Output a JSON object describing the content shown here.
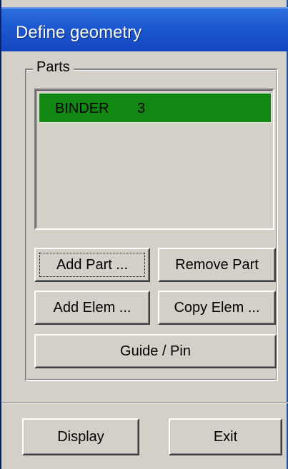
{
  "window": {
    "title": "Define geometry"
  },
  "parts_group": {
    "legend": "Parts",
    "list": [
      {
        "name": "BINDER",
        "number": "3",
        "selected": true,
        "highlight_color": "#118811"
      }
    ]
  },
  "buttons": {
    "add_part": "Add Part ...",
    "remove_part": "Remove Part",
    "add_elem": "Add Elem ...",
    "copy_elem": "Copy Elem ...",
    "guide_pin": "Guide / Pin",
    "display": "Display",
    "exit": "Exit"
  },
  "colors": {
    "titlebar": "#1b58cf",
    "dialog_bg": "#d4d0c8",
    "selection": "#118811"
  }
}
